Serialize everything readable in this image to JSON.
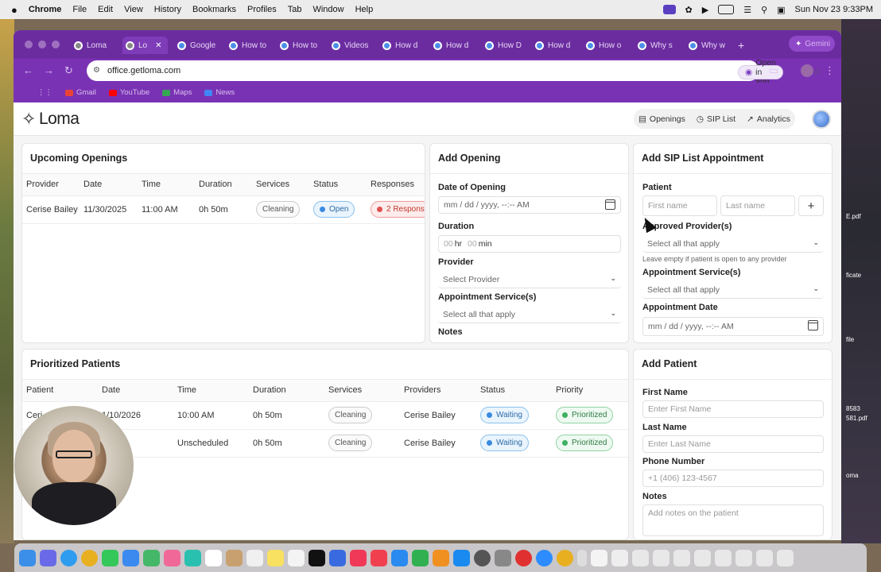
{
  "menubar": {
    "app": "Chrome",
    "items": [
      "File",
      "Edit",
      "View",
      "History",
      "Bookmarks",
      "Profiles",
      "Tab",
      "Window",
      "Help"
    ],
    "clock": "Sun Nov 23  9:33PM"
  },
  "browser": {
    "tabs": [
      {
        "label": "Loma",
        "active": false
      },
      {
        "label": "Lo",
        "active": true
      },
      {
        "label": "Google",
        "active": false
      },
      {
        "label": "How to",
        "active": false
      },
      {
        "label": "How to",
        "active": false
      },
      {
        "label": "Videos",
        "active": false
      },
      {
        "label": "How d",
        "active": false
      },
      {
        "label": "How d",
        "active": false
      },
      {
        "label": "How D",
        "active": false
      },
      {
        "label": "How d",
        "active": false
      },
      {
        "label": "How o",
        "active": false
      },
      {
        "label": "Why s",
        "active": false
      },
      {
        "label": "Why w",
        "active": false
      }
    ],
    "new_tab": "+",
    "gemini": "Gemini",
    "url": "office.getloma.com",
    "open_in_app": "Open in app",
    "bookmarks": [
      "Gmail",
      "YouTube",
      "Maps",
      "News"
    ]
  },
  "app": {
    "logo": "Loma",
    "nav": [
      "Openings",
      "SIP List",
      "Analytics"
    ]
  },
  "upcoming": {
    "title": "Upcoming Openings",
    "columns": [
      "Provider",
      "Date",
      "Time",
      "Duration",
      "Services",
      "Status",
      "Responses"
    ],
    "rows": [
      {
        "provider": "Cerise Bailey",
        "date": "11/30/2025",
        "time": "11:00 AM",
        "duration": "0h 50m",
        "service": "Cleaning",
        "status": "Open",
        "responses": "2 Respons"
      }
    ]
  },
  "add_opening": {
    "title": "Add Opening",
    "date_label": "Date of Opening",
    "date_placeholder": "mm / dd / yyyy,  --:--  AM",
    "duration_label": "Duration",
    "duration_hr": "00",
    "duration_hr_unit": "hr",
    "duration_min": "00",
    "duration_min_unit": "min",
    "provider_label": "Provider",
    "provider_placeholder": "Select Provider",
    "services_label": "Appointment Service(s)",
    "services_placeholder": "Select all that apply",
    "notes_label": "Notes"
  },
  "add_sip": {
    "title": "Add SIP List Appointment",
    "patient_label": "Patient",
    "first_placeholder": "First name",
    "last_placeholder": "Last name",
    "add": "+",
    "providers_label": "Approved Provider(s)",
    "providers_placeholder": "Select all that apply",
    "providers_hint": "Leave empty if patient is open to any provider",
    "services_label": "Appointment Service(s)",
    "services_placeholder": "Select all that apply",
    "date_label": "Appointment Date",
    "date_placeholder": "mm / dd / yyyy,  --:--  AM"
  },
  "prioritized": {
    "title": "Prioritized Patients",
    "columns": [
      "Patient",
      "Date",
      "Time",
      "Duration",
      "Services",
      "Providers",
      "Status",
      "Priority"
    ],
    "rows": [
      {
        "patient": "Ceri",
        "date": "1/10/2026",
        "time": "10:00 AM",
        "duration": "0h 50m",
        "service": "Cleaning",
        "provider": "Cerise Bailey",
        "status": "Waiting",
        "priority": "Prioritized"
      },
      {
        "patient": "",
        "date": "eduled",
        "time": "Unscheduled",
        "duration": "0h 50m",
        "service": "Cleaning",
        "provider": "Cerise Bailey",
        "status": "Waiting",
        "priority": "Prioritized"
      }
    ]
  },
  "add_patient": {
    "title": "Add Patient",
    "first_label": "First Name",
    "first_placeholder": "Enter First Name",
    "last_label": "Last Name",
    "last_placeholder": "Enter Last Name",
    "phone_label": "Phone Number",
    "phone_placeholder": "+1 (406) 123-4567",
    "notes_label": "Notes",
    "notes_placeholder": "Add notes on the patient"
  },
  "desktop_files": [
    "E.pdf",
    "ficate",
    "file",
    "8583",
    "581.pdf",
    "oma"
  ],
  "colors": {
    "browser_purple": "#6b2ca0",
    "open_blue": "#2a6aa8",
    "prioritized_green": "#2e7a45",
    "responses_red": "#c0392b"
  }
}
